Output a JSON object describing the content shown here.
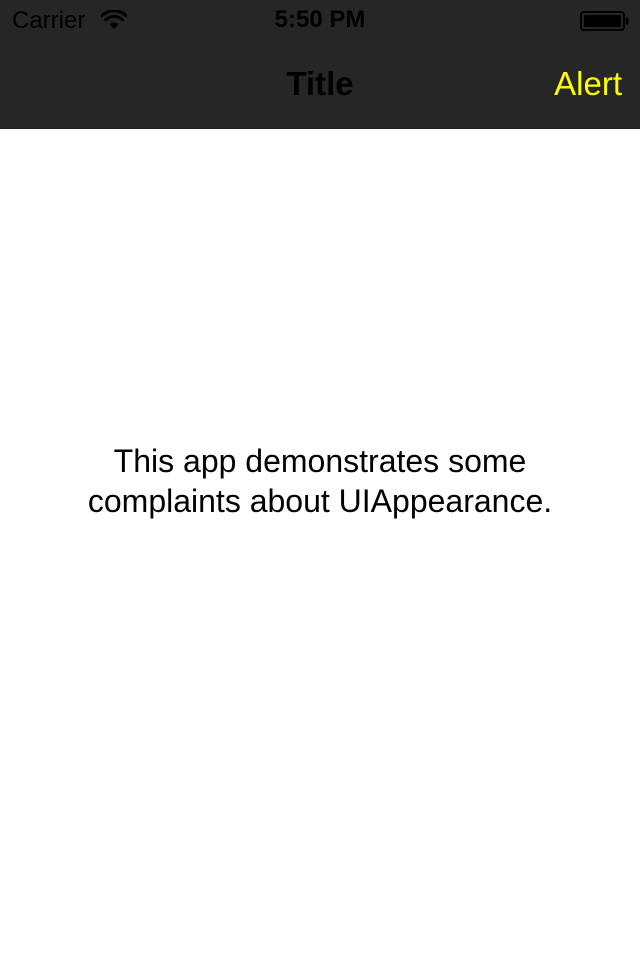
{
  "status_bar": {
    "carrier": "Carrier",
    "time": "5:50 PM",
    "wifi_icon": "wifi-icon",
    "battery_icon": "battery-full-icon"
  },
  "nav_bar": {
    "title": "Title",
    "right_button": "Alert",
    "background_color": "#262626",
    "title_color": "#000000",
    "button_color": "#ffff00"
  },
  "content": {
    "message": "This app demonstrates some complaints about UIAppearance."
  }
}
